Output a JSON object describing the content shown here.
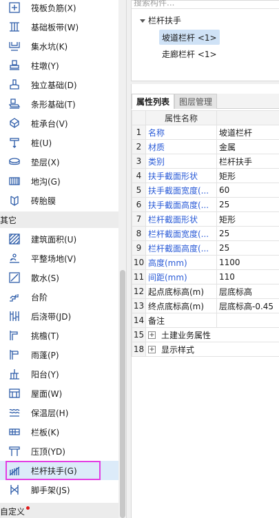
{
  "sidebar": {
    "items_top": [
      {
        "label": "筏板负筋(X)",
        "icon": "raft-negative-rebar-icon"
      },
      {
        "label": "基础板带(W)",
        "icon": "foundation-strip-icon"
      },
      {
        "label": "集水坑(K)",
        "icon": "sump-pit-icon"
      },
      {
        "label": "柱墩(Y)",
        "icon": "column-pier-icon"
      },
      {
        "label": "独立基础(D)",
        "icon": "isolated-footing-icon"
      },
      {
        "label": "条形基础(T)",
        "icon": "strip-footing-icon"
      },
      {
        "label": "桩承台(V)",
        "icon": "pile-cap-icon"
      },
      {
        "label": "桩(U)",
        "icon": "pile-icon"
      },
      {
        "label": "垫层(X)",
        "icon": "cushion-icon"
      },
      {
        "label": "地沟(G)",
        "icon": "trench-icon"
      },
      {
        "label": "砖胎膜",
        "icon": "brick-mold-icon"
      }
    ],
    "group_other": "其它",
    "items_other": [
      {
        "label": "建筑面积(U)",
        "icon": "building-area-icon"
      },
      {
        "label": "平整场地(V)",
        "icon": "site-leveling-icon"
      },
      {
        "label": "散水(S)",
        "icon": "apron-icon"
      },
      {
        "label": "台阶",
        "icon": "steps-icon"
      },
      {
        "label": "后浇带(JD)",
        "icon": "post-cast-strip-icon"
      },
      {
        "label": "挑檐(T)",
        "icon": "overhang-eave-icon"
      },
      {
        "label": "雨蓬(P)",
        "icon": "canopy-icon"
      },
      {
        "label": "阳台(Y)",
        "icon": "balcony-icon"
      },
      {
        "label": "屋面(W)",
        "icon": "roof-icon"
      },
      {
        "label": "保温层(H)",
        "icon": "insulation-icon"
      },
      {
        "label": "栏板(K)",
        "icon": "parapet-icon"
      },
      {
        "label": "压顶(YD)",
        "icon": "coping-icon"
      },
      {
        "label": "栏杆扶手(G)",
        "icon": "railing-icon"
      },
      {
        "label": "脚手架(JS)",
        "icon": "scaffold-icon"
      }
    ],
    "group_custom": "自定义"
  },
  "tree": {
    "search_placeholder": "搜索构件...",
    "root": "栏杆扶手",
    "children": [
      "坡道栏杆 <1>",
      "走廊栏杆 <1>"
    ]
  },
  "props": {
    "tabs": [
      "属性列表",
      "图层管理"
    ],
    "header": "属性名称",
    "rows": [
      {
        "num": "1",
        "name": "名称",
        "value": "坡道栏杆",
        "blue": true
      },
      {
        "num": "2",
        "name": "材质",
        "value": "金属",
        "blue": true
      },
      {
        "num": "3",
        "name": "类别",
        "value": "栏杆扶手",
        "blue": true
      },
      {
        "num": "4",
        "name": "扶手截面形状",
        "value": "矩形",
        "blue": true
      },
      {
        "num": "5",
        "name": "扶手截面宽度(...",
        "value": "60",
        "blue": true
      },
      {
        "num": "6",
        "name": "扶手截面高度(...",
        "value": "25",
        "blue": true
      },
      {
        "num": "7",
        "name": "栏杆截面形状",
        "value": "矩形",
        "blue": true
      },
      {
        "num": "8",
        "name": "栏杆截面宽度(...",
        "value": "25",
        "blue": true
      },
      {
        "num": "9",
        "name": "栏杆截面高度(...",
        "value": "25",
        "blue": true
      },
      {
        "num": "10",
        "name": "高度(mm)",
        "value": "1100",
        "blue": true
      },
      {
        "num": "11",
        "name": "间距(mm)",
        "value": "110",
        "blue": true
      },
      {
        "num": "12",
        "name": "起点底标高(m)",
        "value": "层底标高",
        "blue": false
      },
      {
        "num": "13",
        "name": "终点底标高(m)",
        "value": "层底标高-0.45",
        "blue": false
      },
      {
        "num": "14",
        "name": "备注",
        "value": "",
        "blue": false
      },
      {
        "num": "15",
        "name": "土建业务属性",
        "value": "",
        "blue": false,
        "group": true
      },
      {
        "num": "18",
        "name": "显示样式",
        "value": "",
        "blue": false,
        "group": true
      }
    ]
  },
  "colors": {
    "accent_blue_text": "#2a5bd7",
    "selection_bg": "#dcebf9",
    "highlight_outline": "#e33ee3",
    "icon_blue": "#2b5aa8"
  }
}
